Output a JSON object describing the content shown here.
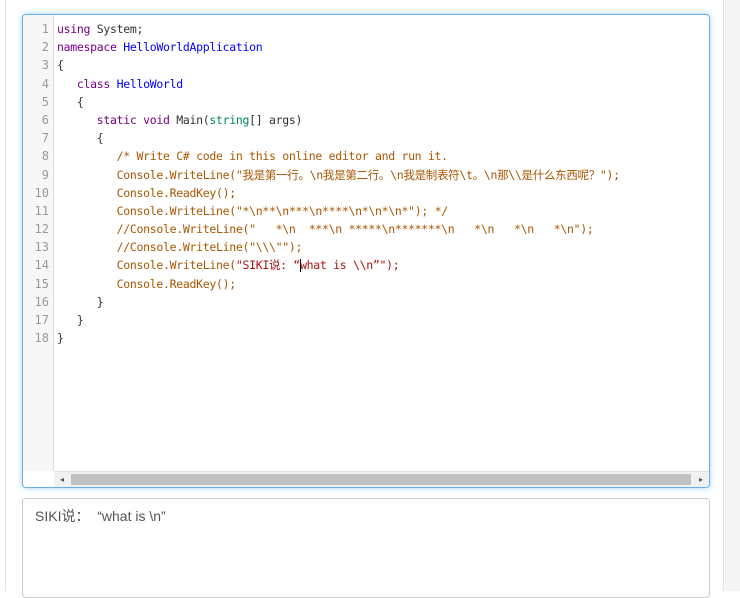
{
  "editor": {
    "line_numbers": [
      "1",
      "2",
      "3",
      "4",
      "5",
      "6",
      "7",
      "8",
      "9",
      "10",
      "11",
      "12",
      "13",
      "14",
      "15",
      "16",
      "17",
      "18"
    ],
    "lines": {
      "l1_kw": "using",
      "l1_rest": " System;",
      "l2_kw": "namespace",
      "l2_name": " HelloWorldApplication",
      "l3": "{",
      "l4_indent": "   ",
      "l4_kw": "class",
      "l4_name": " HelloWorld",
      "l5": "   {",
      "l6_indent": "      ",
      "l6_kw1": "static",
      "l6_sp": " ",
      "l6_kw2": "void",
      "l6_main": " Main(",
      "l6_type": "string",
      "l6_rest": "[] args)",
      "l7": "      {",
      "l8_indent": "         ",
      "l8_comment": "/* Write C# code in this online editor and run it.",
      "l9_indent": "         ",
      "l9_call": "Console.WriteLine(",
      "l9_str": "\"我是第一行。\\n我是第二行。\\n我是制表符\\t。\\n那\\\\是什么东西呢？\");",
      "l10": "         Console.ReadKey();",
      "l11_indent": "         ",
      "l11_call": "Console.WriteLine(",
      "l11_str": "\"*\\n**\\n***\\n****\\n*\\n*\\n*\"); */",
      "l12_indent": "         ",
      "l12_comment": "//Console.WriteLine(\"   *\\n  ***\\n *****\\n*******\\n   *\\n   *\\n   *\\n\");",
      "l13_indent": "         ",
      "l13_comment": "//Console.WriteLine(\"\\\\\\\"\");",
      "l14_indent": "         ",
      "l14_call": "Console.WriteLine(",
      "l14_str_a": "\"SIKI说: “",
      "l14_str_b": "what is \\\\n”\");",
      "l15": "         Console.ReadKey();",
      "l16": "      }",
      "l17": "   }",
      "l18": "}"
    }
  },
  "scrollbar": {
    "left_arrow": "◂",
    "right_arrow": "▸"
  },
  "output": {
    "text": "SIKI说：  “what is \\n”"
  }
}
